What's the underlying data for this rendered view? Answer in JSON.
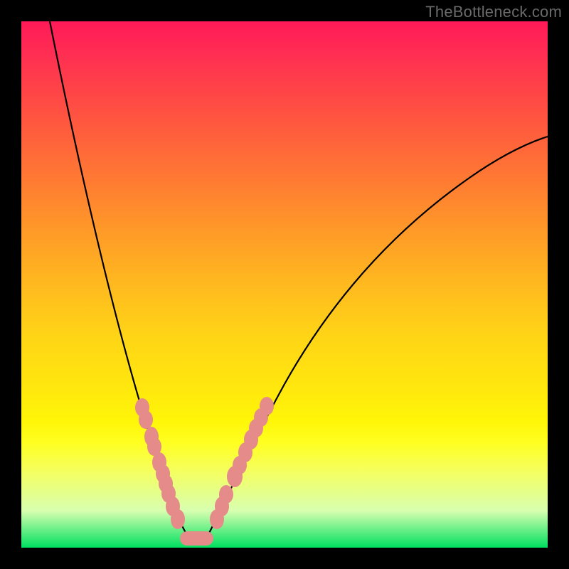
{
  "watermark": "TheBottleneck.com",
  "colors": {
    "gradient_top": "#ff1a57",
    "gradient_bottom": "#00e060",
    "curve": "#000000",
    "markers": "#e58b89",
    "background": "#000000"
  },
  "chart_data": {
    "type": "line",
    "title": "",
    "xlabel": "",
    "ylabel": "",
    "xlim": [
      30,
      770
    ],
    "ylim": [
      30,
      770
    ],
    "note": "Axes unlabeled; values are pixel-space estimates of the drawn curve. Lower y means closer to top (higher bottleneck).",
    "series": [
      {
        "name": "bottleneck-curve",
        "x": [
          70,
          90,
          110,
          130,
          150,
          170,
          190,
          210,
          225,
          240,
          255,
          270,
          280,
          300,
          330,
          370,
          420,
          480,
          550,
          630,
          720,
          770
        ],
        "y": [
          30,
          120,
          210,
          300,
          380,
          460,
          530,
          600,
          650,
          700,
          740,
          760,
          760,
          740,
          680,
          600,
          520,
          440,
          360,
          290,
          225,
          195
        ]
      }
    ],
    "markers_left": [
      {
        "x": 200,
        "y": 573
      },
      {
        "x": 205,
        "y": 590
      },
      {
        "x": 213,
        "y": 614
      },
      {
        "x": 217,
        "y": 628
      },
      {
        "x": 224,
        "y": 650
      },
      {
        "x": 229,
        "y": 666
      },
      {
        "x": 233,
        "y": 680
      },
      {
        "x": 237,
        "y": 694
      },
      {
        "x": 243,
        "y": 712
      },
      {
        "x": 250,
        "y": 730
      }
    ],
    "markers_right": [
      {
        "x": 305,
        "y": 730
      },
      {
        "x": 312,
        "y": 712
      },
      {
        "x": 318,
        "y": 695
      },
      {
        "x": 330,
        "y": 670
      },
      {
        "x": 337,
        "y": 654
      },
      {
        "x": 345,
        "y": 636
      },
      {
        "x": 353,
        "y": 618
      },
      {
        "x": 360,
        "y": 602
      },
      {
        "x": 367,
        "y": 587
      },
      {
        "x": 375,
        "y": 571
      }
    ],
    "bottom_pill": {
      "x1": 253,
      "y": 756,
      "x2": 300
    }
  }
}
